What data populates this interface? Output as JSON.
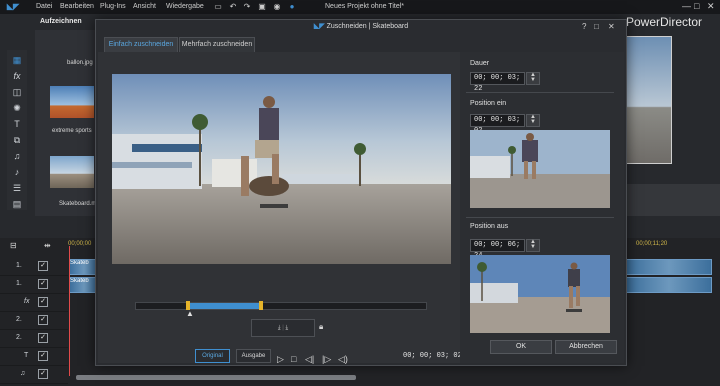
{
  "menu": {
    "items": [
      "Datei",
      "Bearbeiten",
      "Plug-Ins",
      "Ansicht",
      "Wiedergabe"
    ],
    "project_title": "Neues Projekt ohne Titel*"
  },
  "app": {
    "brand": "PowerDirector",
    "capture_tab": "Aufzeichnen",
    "media_labels": [
      "ballon.jpg",
      "extreme sports",
      "Skateboard.m"
    ]
  },
  "timeline": {
    "times": [
      "00;00;00",
      "00;00;11;20"
    ],
    "track_numbers": [
      "1.",
      "1.",
      "2.",
      "2.",
      "3.",
      "3."
    ],
    "clip_labels": [
      "Skateb",
      "Skateb"
    ]
  },
  "dialog": {
    "title": "Zuschneiden | Skateboard",
    "tabs": [
      "Einfach zuschneiden",
      "Mehrfach zuschneiden"
    ],
    "duration_label": "Dauer",
    "duration_value": "00; 00; 03; 22",
    "mark_in_label": "Position ein",
    "mark_in_value": "00; 00; 03; 02",
    "mark_out_label": "Position aus",
    "mark_out_value": "00; 00; 06; 24",
    "view_original": "Original",
    "view_output": "Ausgabe",
    "current_time": "00; 00; 03; 02",
    "ok": "OK",
    "cancel": "Abbrechen",
    "help": "?"
  },
  "scrubber": {
    "start_fraction": 0.18,
    "end_fraction": 0.43
  },
  "colors": {
    "accent": "#3f8fd0",
    "marker": "#e5b32a",
    "active_tab_text": "#5aa7e0"
  }
}
